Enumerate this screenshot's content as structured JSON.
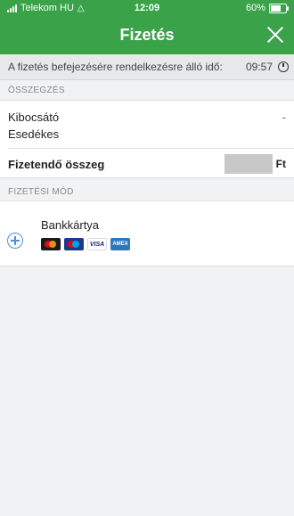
{
  "status_bar": {
    "carrier": "Telekom HU",
    "time": "12:09",
    "battery": "60%"
  },
  "header": {
    "title": "Fizetés"
  },
  "timer": {
    "label": "A fizetés befejezésére rendelkezésre álló idő:",
    "countdown": "09:57"
  },
  "summary": {
    "section_title": "ÖSSZEGZÉS",
    "issuer_label": "Kibocsátó",
    "issuer_value": "-",
    "due_label": "Esedékes",
    "amount_label": "Fizetendő összeg",
    "currency": "Ft"
  },
  "payment": {
    "section_title": "FIZETÉSI MÓD",
    "method_label": "Bankkártya",
    "cards": [
      "mastercard",
      "maestro",
      "VISA",
      "AMEX"
    ]
  },
  "colors": {
    "header_bg": "#3aa34a",
    "accent": "#4a90d9"
  }
}
